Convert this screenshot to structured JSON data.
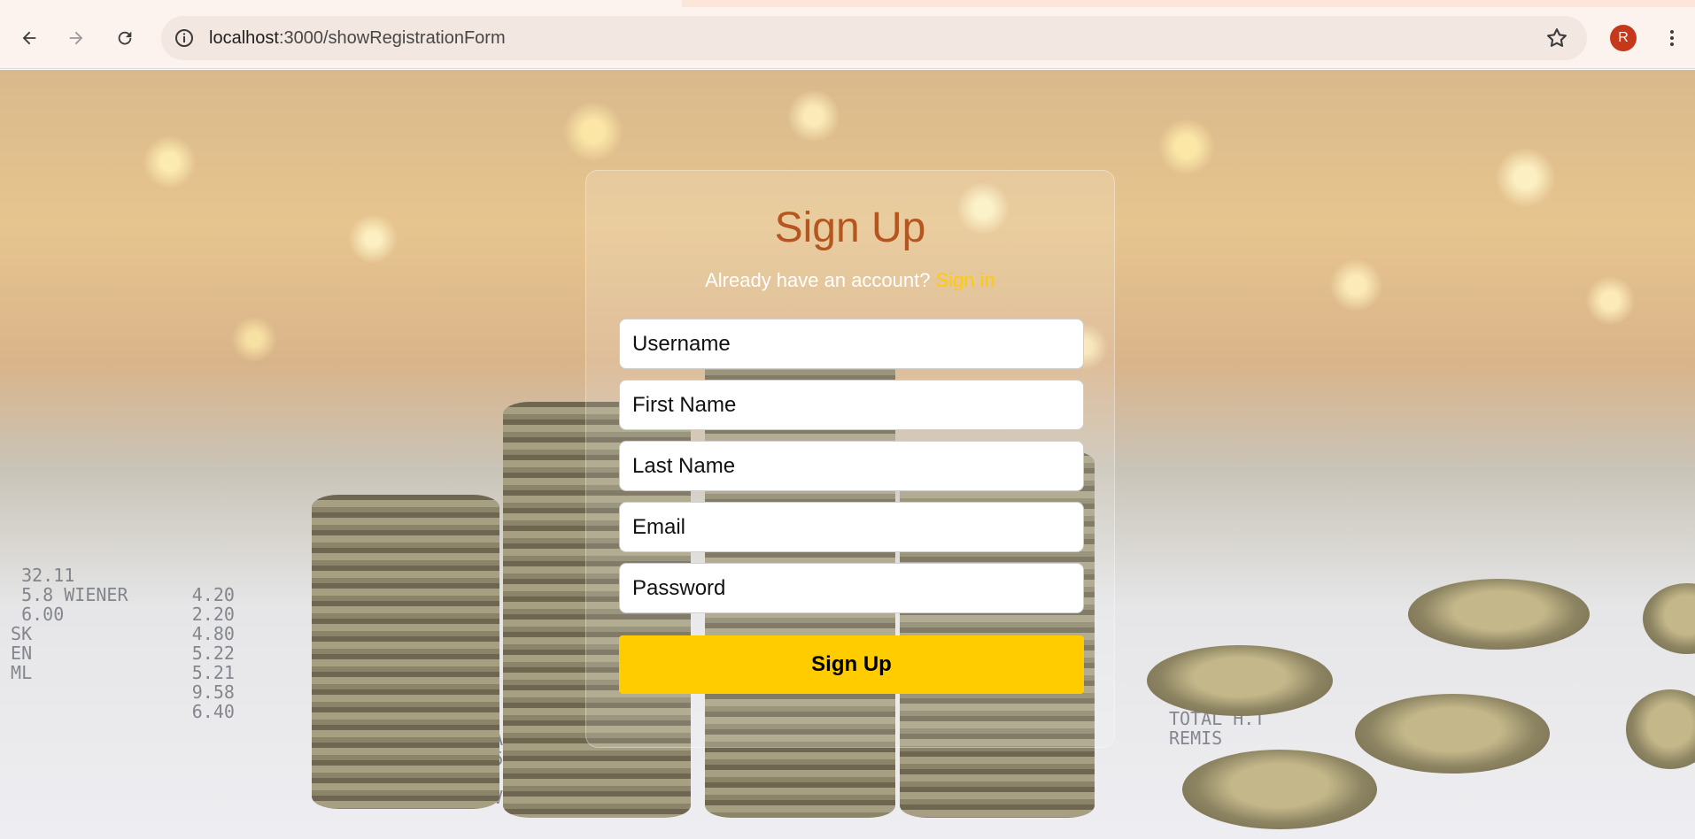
{
  "browser": {
    "url_host": "localhost",
    "url_path": ":3000/showRegistrationForm",
    "profile_initial": "R",
    "icons": {
      "back": "arrow-left-icon",
      "forward": "arrow-right-icon",
      "reload": "reload-icon",
      "site_info": "info-icon",
      "bookmark": "star-icon",
      "menu": "kebab-menu-icon"
    }
  },
  "form": {
    "title": "Sign Up",
    "signin_prompt": "Already have an account?",
    "signin_link": "Sign in",
    "fields": {
      "username": "Username",
      "first_name": "First Name",
      "last_name": "Last Name",
      "email": "Email",
      "password": "Password"
    },
    "submit_label": "Sign Up"
  },
  "colors": {
    "title": "#b5551f",
    "link": "#ffcb05",
    "button": "#ffcc00"
  }
}
